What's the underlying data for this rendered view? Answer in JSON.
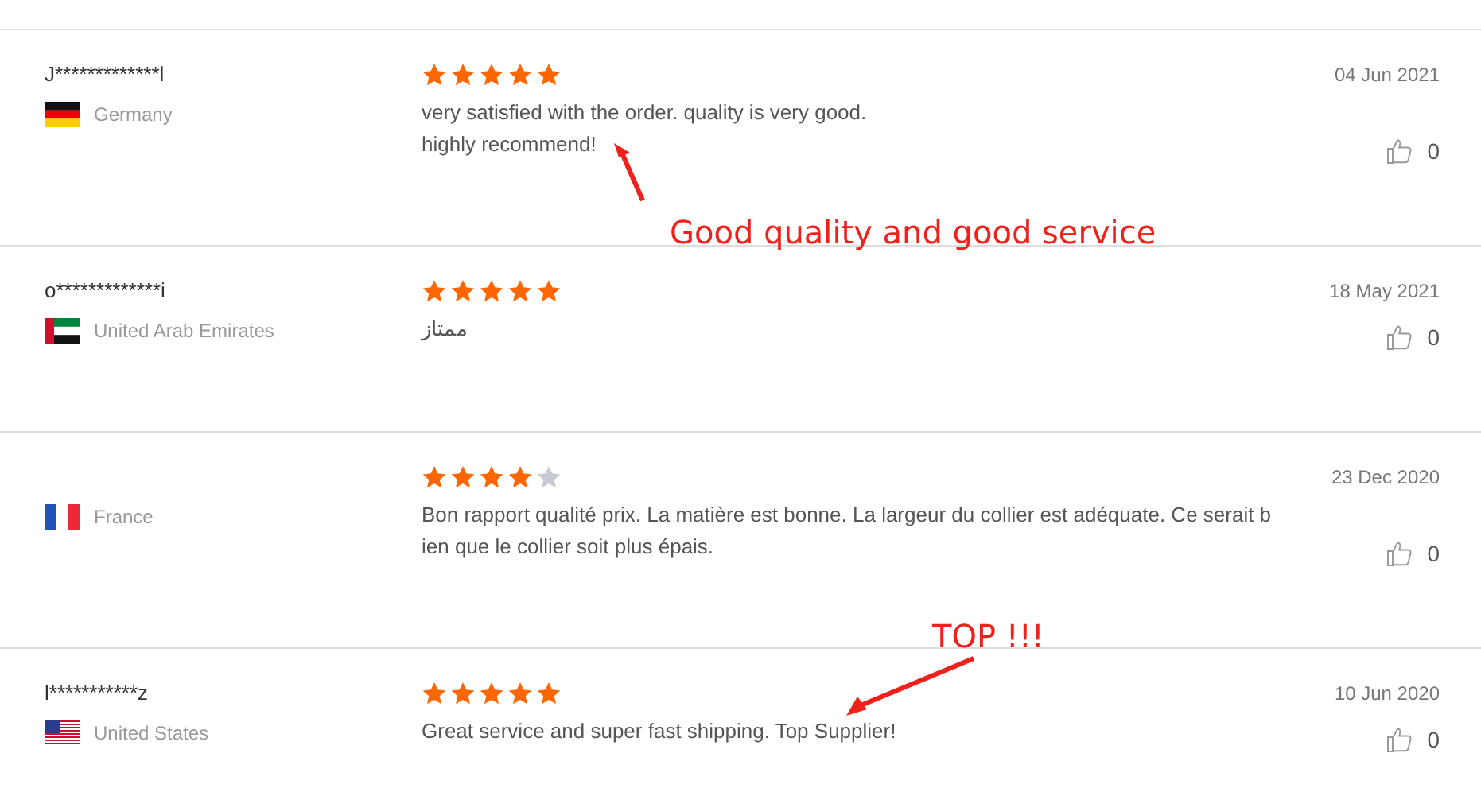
{
  "reviews": [
    {
      "name": "J*************l",
      "kind": "de",
      "country": "Germany",
      "stars": 5,
      "lines": [
        "very satisfied with the order. quality is very good.",
        "highly recommend!"
      ],
      "date": "04 Jun 2021",
      "likes": "0"
    },
    {
      "name": "o*************i",
      "kind": "ae",
      "country": "United Arab Emirates",
      "stars": 5,
      "lines": [
        "ممتاز"
      ],
      "date": "18 May 2021",
      "likes": "0"
    },
    {
      "kind": "fr",
      "country": "France",
      "stars": 4,
      "lines": [
        "Bon rapport qualité prix. La matière est bonne. La largeur du collier est adéquate. Ce serait b",
        "ien que le collier soit plus épais."
      ],
      "date": "23 Dec 2020",
      "likes": "0"
    },
    {
      "name": "l***********z",
      "kind": "us",
      "country": "United States",
      "stars": 5,
      "lines": [
        "Great service and super fast shipping. Top Supplier!"
      ],
      "date": "10 Jun 2020",
      "likes": "0"
    }
  ],
  "annotations": [
    {
      "text": "Good quality and good service"
    },
    {
      "text": "TOP !!!"
    }
  ]
}
